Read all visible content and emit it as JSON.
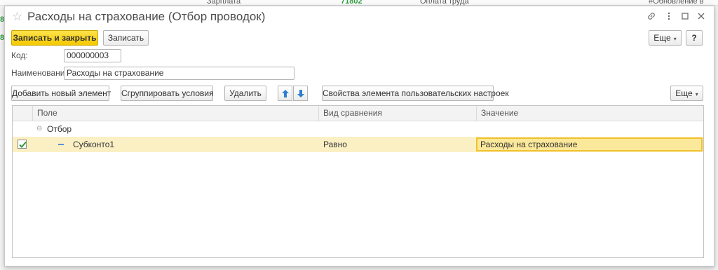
{
  "background": {
    "text_1": "Зарплата",
    "number": "71802",
    "text_2": "Оплата труда",
    "text_3": "#Обновление в",
    "side_1": "8",
    "side_2": "8"
  },
  "window": {
    "title": "Расходы на страхование (Отбор проводок)",
    "icons": [
      "link-icon",
      "more-vert-icon",
      "maximize-icon",
      "close-icon"
    ]
  },
  "toolbar": {
    "save_close_label": "Записать и закрыть",
    "save_label": "Записать",
    "more_label": "Еще",
    "help_label": "?"
  },
  "form": {
    "code_label": "Код:",
    "code_value": "000000003",
    "name_label": "Наименование:",
    "name_value": "Расходы на страхование"
  },
  "filter_toolbar": {
    "add_label": "Добавить новый элемент",
    "group_label": "Сгруппировать условия",
    "delete_label": "Удалить",
    "settings_label": "Свойства элемента пользовательских настроек",
    "more_label": "Еще"
  },
  "table": {
    "columns": [
      "Поле",
      "Вид сравнения",
      "Значение"
    ],
    "group_row": {
      "label": "Отбор"
    },
    "item_row": {
      "checked": true,
      "field": "Субконто1",
      "comparison": "Равно",
      "value": "Расходы на страхование"
    }
  },
  "colors": {
    "primary_button": "#f5c900",
    "selected_row": "#fbf0c4",
    "value_cell_border": "#f0c230",
    "arrow_blue": "#2e7fd0",
    "check_green": "#2e9a3e"
  }
}
